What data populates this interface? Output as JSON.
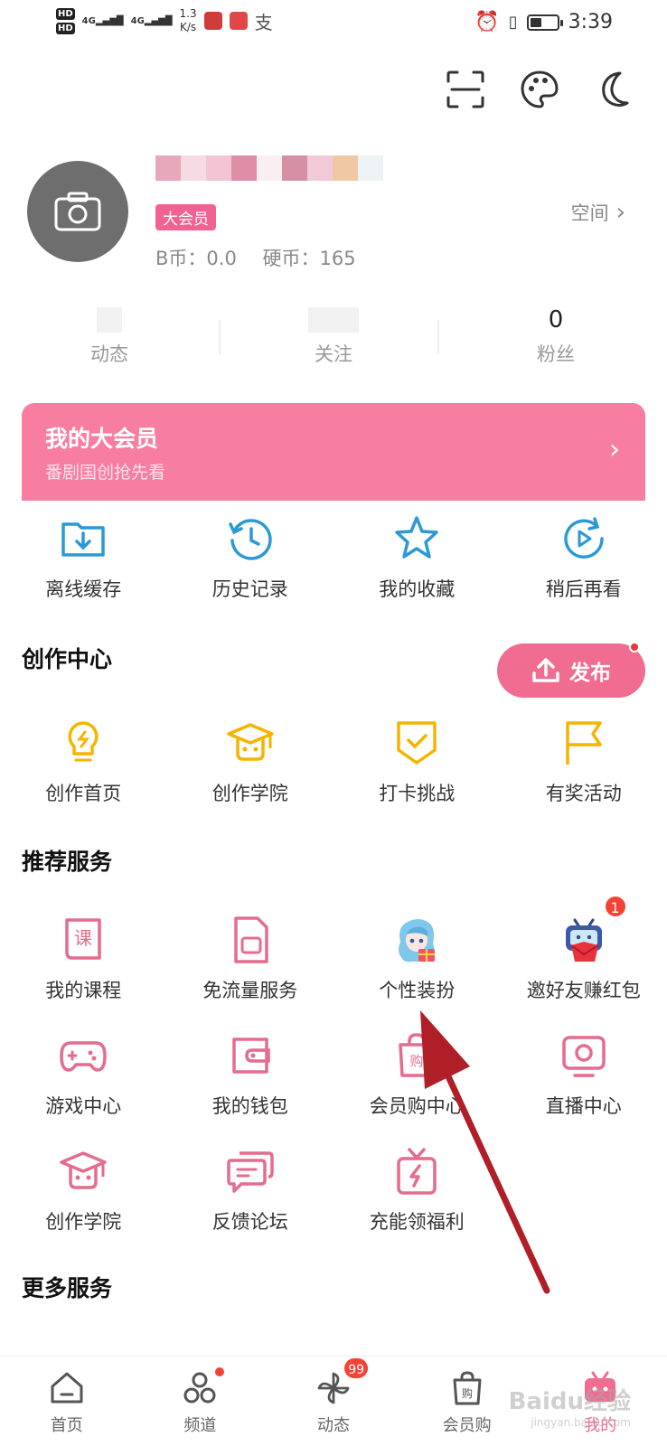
{
  "status_bar": {
    "hd_top": "HD",
    "hd_bottom": "HD",
    "signal1": "4G",
    "signal2": "4G",
    "speed_value": "1.3",
    "speed_unit": "K/s",
    "time": "3:39",
    "battery_level": 0.45
  },
  "profile": {
    "vip_tag": "大会员",
    "b_coin": "B币：0.0",
    "coin": "硬币：165",
    "space_label": "空间"
  },
  "stats": [
    {
      "value": "",
      "label": "动态"
    },
    {
      "value": "",
      "label": "关注"
    },
    {
      "value": "0",
      "label": "粉丝"
    }
  ],
  "vip_banner": {
    "title": "我的大会员",
    "subtitle": "番剧国创抢先看"
  },
  "quick_actions": [
    {
      "label": "离线缓存",
      "icon": "download-folder-icon"
    },
    {
      "label": "历史记录",
      "icon": "history-clock-icon"
    },
    {
      "label": "我的收藏",
      "icon": "star-icon"
    },
    {
      "label": "稍后再看",
      "icon": "watch-later-icon"
    }
  ],
  "creation": {
    "title": "创作中心",
    "publish_label": "发布",
    "items": [
      {
        "label": "创作首页",
        "icon": "lightbulb-icon"
      },
      {
        "label": "创作学院",
        "icon": "graduation-cap-icon"
      },
      {
        "label": "打卡挑战",
        "icon": "check-badge-icon"
      },
      {
        "label": "有奖活动",
        "icon": "flag-icon"
      }
    ]
  },
  "recommended": {
    "title": "推荐服务",
    "rows": [
      [
        {
          "label": "我的课程",
          "icon": "course-book-icon"
        },
        {
          "label": "免流量服务",
          "icon": "sim-card-icon"
        },
        {
          "label": "个性装扮",
          "icon": "character-avatar-icon"
        },
        {
          "label": "邀好友赚红包",
          "icon": "tv-mascot-envelope-icon",
          "badge": "1"
        }
      ],
      [
        {
          "label": "游戏中心",
          "icon": "gamepad-icon"
        },
        {
          "label": "我的钱包",
          "icon": "wallet-icon"
        },
        {
          "label": "会员购中心",
          "icon": "shopping-bag-icon"
        },
        {
          "label": "直播中心",
          "icon": "live-tv-icon"
        }
      ],
      [
        {
          "label": "创作学院",
          "icon": "graduation-cap-icon"
        },
        {
          "label": "反馈论坛",
          "icon": "chat-bubbles-icon"
        },
        {
          "label": "充能领福利",
          "icon": "gift-lightning-icon"
        }
      ]
    ]
  },
  "more_services": {
    "title": "更多服务"
  },
  "tabbar": [
    {
      "label": "首页",
      "icon": "home-icon"
    },
    {
      "label": "频道",
      "icon": "channel-circles-icon"
    },
    {
      "label": "动态",
      "icon": "pinwheel-icon",
      "badge": "99"
    },
    {
      "label": "会员购",
      "icon": "shopping-bag-icon"
    },
    {
      "label": "我的",
      "icon": "tv-mascot-icon"
    }
  ],
  "watermark": {
    "text": "Baidu经验",
    "sub": "jingyan.baidu.com"
  },
  "colors": {
    "accent": "#f06c90",
    "vip_banner": "#f77ea0",
    "blue_icon": "#2a9ad6",
    "yellow_icon": "#f5b400"
  }
}
